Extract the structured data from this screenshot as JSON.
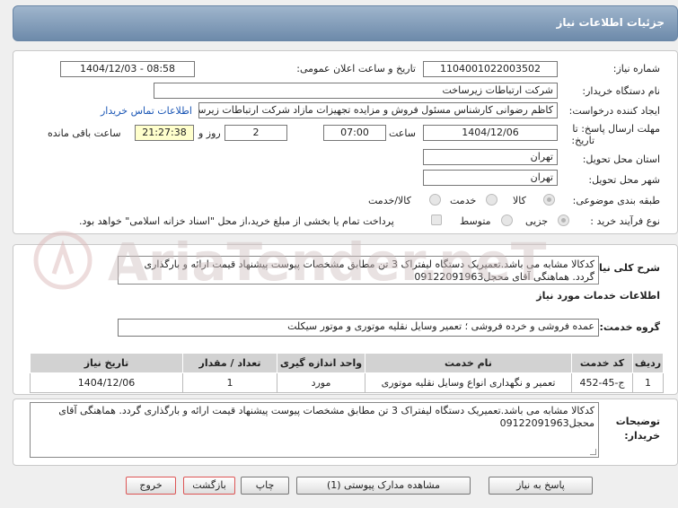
{
  "header": {
    "title": "جزئیات اطلاعات نیاز"
  },
  "form": {
    "need_number_label": "شماره نیاز:",
    "need_number": "1104001022003502",
    "announce_label": "تاریخ و ساعت اعلان عمومی:",
    "announce_value": "1404/12/03 - 08:58",
    "buyer_org_label": "نام دستگاه خریدار:",
    "buyer_org": "شرکت ارتباطات زیرساخت",
    "creator_label": "ایجاد کننده درخواست:",
    "creator": "کاظم رضوانی کارشناس مسئول فروش و مزایده تجهیزات مازاد شرکت ارتباطات زیرساخت",
    "contact_link": "اطلاعات تماس خریدار",
    "deadline_label_1": "مهلت ارسال پاسخ: تا",
    "deadline_label_2": "تاریخ:",
    "deadline_date": "1404/12/06",
    "time_label": "ساعت",
    "deadline_time": "07:00",
    "days_value": "2",
    "days_label": "روز و",
    "remaining_time": "21:27:38",
    "remaining_label": "ساعت باقی مانده",
    "province_label": "استان محل تحویل:",
    "province": "تهران",
    "city_label": "شهر محل تحویل:",
    "city": "تهران",
    "category_label": "طبقه بندی موضوعی:",
    "category_options": [
      "کالا",
      "خدمت",
      "کالا/خدمت"
    ],
    "process_label": "نوع فرآیند خرید :",
    "process_options": [
      "جزیی",
      "متوسط"
    ],
    "payment_note": "پرداخت تمام یا بخشی از مبلغ خرید،از محل \"اسناد خزانه اسلامی\" خواهد بود."
  },
  "description": {
    "label": "شرح کلی نیاز:",
    "text": "کدکالا مشابه می باشد.تعمیریک دستگاه لیفتراک 3 تن مطابق مشخصات پیوست پیشنهاد قیمت ارائه و بارگذاری گردد. هماهنگی آقای محجل09122091963"
  },
  "services": {
    "section_title": "اطلاعات خدمات مورد نیاز",
    "group_label": "گروه خدمت:",
    "group_value": "عمده فروشی و خرده فروشی ؛ تعمیر وسایل نقلیه موتوری و موتور سیکلت",
    "columns": [
      "ردیف",
      "کد خدمت",
      "نام خدمت",
      "واحد اندازه گیری",
      "تعداد / مقدار",
      "تاریخ نیاز"
    ],
    "rows": [
      [
        "1",
        "ج-45-452",
        "تعمیر و نگهداری انواع وسایل نقلیه موتوری",
        "مورد",
        "1",
        "1404/12/06"
      ]
    ]
  },
  "buyer_notes": {
    "label": "توضیحات خریدار:",
    "text": "کدکالا مشابه می باشد.تعمیریک دستگاه لیفتراک 3 تن مطابق مشخصات پیوست پیشنهاد قیمت ارائه و بارگذاری گردد. هماهنگی آقای محجل09122091963"
  },
  "buttons": {
    "reply": "پاسخ به نیاز",
    "attachments": "مشاهده مدارک پیوستی (1)",
    "print": "چاپ",
    "back": "بازگشت",
    "exit": "خروج"
  },
  "watermark": "AriaTender.neT",
  "colors": {
    "header": "#7d97b5",
    "link": "#1a56b5",
    "remaining_bg": "#ffffcc",
    "red_button_border": "#dd5555"
  }
}
